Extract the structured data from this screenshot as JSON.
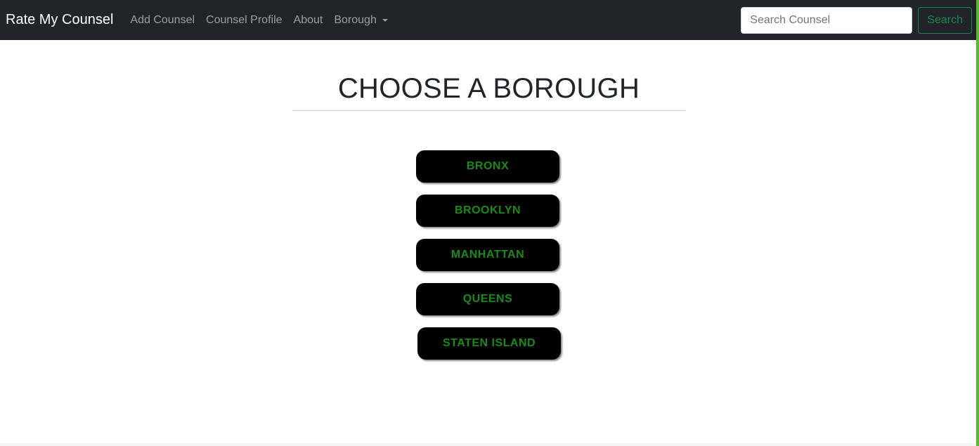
{
  "navbar": {
    "brand": "Rate My Counsel",
    "links": [
      {
        "label": "Add Counsel"
      },
      {
        "label": "Counsel Profile"
      },
      {
        "label": "About"
      }
    ],
    "dropdown_label": "Borough",
    "search": {
      "placeholder": "Search Counsel",
      "value": "",
      "button_label": "Search"
    }
  },
  "main": {
    "title": "CHOOSE A BOROUGH",
    "boroughs": [
      {
        "label": "BRONX"
      },
      {
        "label": "BROOKLYN"
      },
      {
        "label": "MANHATTAN"
      },
      {
        "label": "QUEENS"
      },
      {
        "label": "STATEN ISLAND"
      }
    ]
  },
  "colors": {
    "navbar_bg": "#212529",
    "accent_green": "#198754",
    "borough_text": "#1a8a1a",
    "borough_bg": "#000000",
    "right_border": "#5cb83a"
  },
  "icons": {
    "dropdown": "caret-down-icon"
  }
}
